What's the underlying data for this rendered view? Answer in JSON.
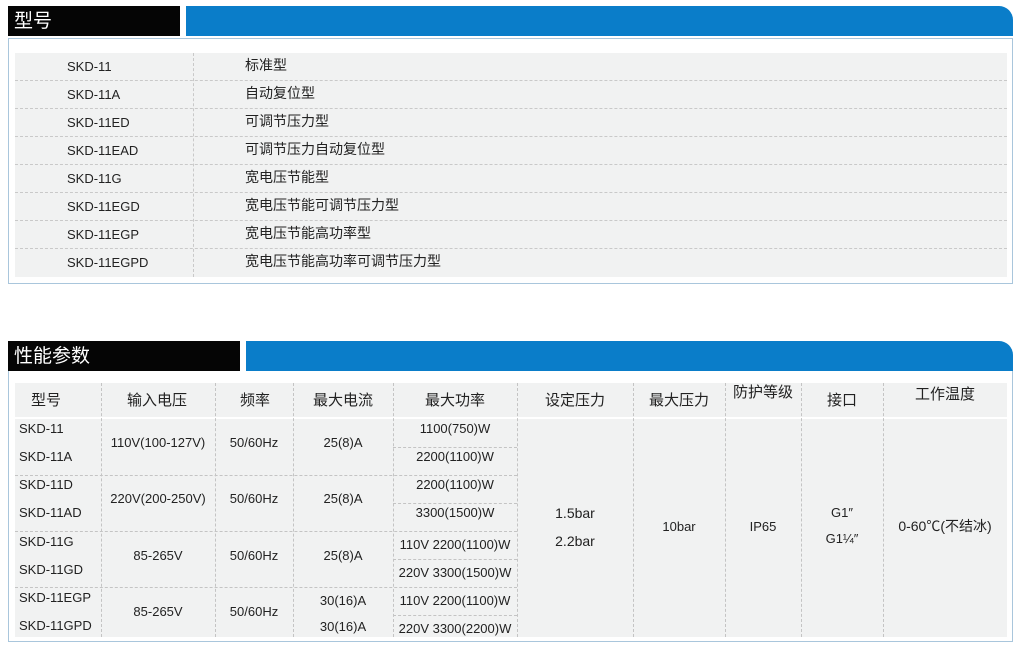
{
  "section1": {
    "title": "型号"
  },
  "models": [
    {
      "code": "SKD-11",
      "desc": "标准型"
    },
    {
      "code": "SKD-11A",
      "desc": "自动复位型"
    },
    {
      "code": "SKD-11ED",
      "desc": "可调节压力型"
    },
    {
      "code": "SKD-11EAD",
      "desc": "可调节压力自动复位型"
    },
    {
      "code": "SKD-11G",
      "desc": "宽电压节能型"
    },
    {
      "code": "SKD-11EGD",
      "desc": "宽电压节能可调节压力型"
    },
    {
      "code": "SKD-11EGP",
      "desc": "宽电压节能高功率型"
    },
    {
      "code": "SKD-11EGPD",
      "desc": "宽电压节能高功率可调节压力型"
    }
  ],
  "section2": {
    "title": "性能参数"
  },
  "perf": {
    "headers": {
      "model": "型号",
      "input_voltage": "输入电压",
      "frequency": "频率",
      "max_current": "最大电流",
      "max_power": "最大功率",
      "set_pressure": "设定压力",
      "max_pressure": "最大压力",
      "protection": "防护等级",
      "interface": "接口",
      "temperature": "工作温度"
    },
    "groups": [
      {
        "models": [
          "SKD-11",
          "SKD-11A"
        ],
        "voltage": "110V(100-127V)",
        "frequency": "50/60Hz",
        "current": [
          "25(8)A"
        ],
        "power": [
          "1100(750)W",
          "2200(1100)W"
        ]
      },
      {
        "models": [
          "SKD-11D",
          "SKD-11AD"
        ],
        "voltage": "220V(200-250V)",
        "frequency": "50/60Hz",
        "current": [
          "25(8)A"
        ],
        "power": [
          "2200(1100)W",
          "3300(1500)W"
        ]
      },
      {
        "models": [
          "SKD-11G",
          "SKD-11GD"
        ],
        "voltage": "85-265V",
        "frequency": "50/60Hz",
        "current": [
          "25(8)A"
        ],
        "power": [
          "110V 2200(1100)W",
          "220V 3300(1500)W"
        ]
      },
      {
        "models": [
          "SKD-11EGP",
          "SKD-11GPD"
        ],
        "voltage": "85-265V",
        "frequency": "50/60Hz",
        "current": [
          "30(16)A",
          "30(16)A"
        ],
        "power": [
          "110V 2200(1100)W",
          "220V 3300(2200)W"
        ]
      }
    ],
    "set_pressure": [
      "1.5bar",
      "2.2bar"
    ],
    "max_pressure": "10bar",
    "protection": "IP65",
    "interface": [
      "G1″",
      "G1¼″"
    ],
    "temperature": "0-60℃(不结冰)"
  },
  "colors": {
    "header_black": "#050505",
    "header_blue": "#0a7dc9",
    "row_bg": "#f1f2f2",
    "border": "#a9c6dc"
  }
}
